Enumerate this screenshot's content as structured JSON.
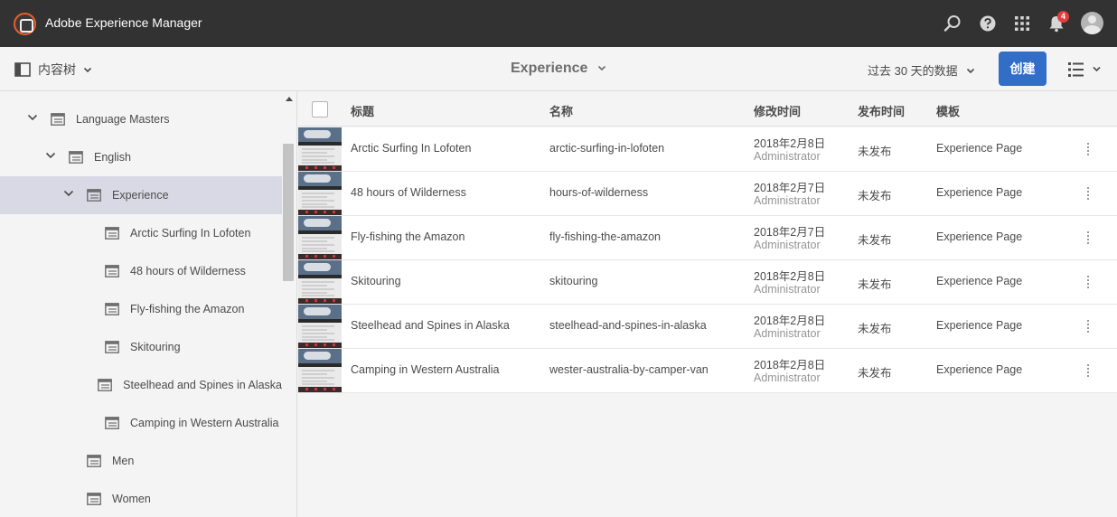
{
  "header": {
    "app_title": "Adobe Experience Manager",
    "notification_count": "4",
    "icons": [
      "search-icon",
      "help-icon",
      "solutions-grid-icon",
      "bell-icon",
      "user-avatar-icon"
    ]
  },
  "actionbar": {
    "rail_label": "内容树",
    "title": "Experience",
    "date_range": "过去 30 天的数据",
    "create_label": "创建"
  },
  "tree": [
    {
      "label": "Language Masters",
      "level": 0,
      "expanded": true,
      "selected": false
    },
    {
      "label": "English",
      "level": 1,
      "expanded": true,
      "selected": false
    },
    {
      "label": "Experience",
      "level": 2,
      "expanded": true,
      "selected": true
    },
    {
      "label": "Arctic Surfing In Lofoten",
      "level": 3,
      "expanded": false,
      "selected": false
    },
    {
      "label": "48 hours of Wilderness",
      "level": 3,
      "expanded": false,
      "selected": false
    },
    {
      "label": "Fly-fishing the Amazon",
      "level": 3,
      "expanded": false,
      "selected": false
    },
    {
      "label": "Skitouring",
      "level": 3,
      "expanded": false,
      "selected": false
    },
    {
      "label": "Steelhead and Spines in Alaska",
      "level": 3,
      "expanded": false,
      "selected": false
    },
    {
      "label": "Camping in Western Australia",
      "level": 3,
      "expanded": false,
      "selected": false
    },
    {
      "label": "Men",
      "level": 2,
      "expanded": false,
      "selected": false
    },
    {
      "label": "Women",
      "level": 2,
      "expanded": false,
      "selected": false
    }
  ],
  "table": {
    "columns": [
      "标题",
      "名称",
      "修改时间",
      "发布时间",
      "模板"
    ],
    "rows": [
      {
        "title": "Arctic Surfing In Lofoten",
        "name": "arctic-surfing-in-lofoten",
        "modified": "2018年2月8日",
        "modified_by": "Administrator",
        "published": "未发布",
        "template": "Experience Page"
      },
      {
        "title": "48 hours of Wilderness",
        "name": "hours-of-wilderness",
        "modified": "2018年2月7日",
        "modified_by": "Administrator",
        "published": "未发布",
        "template": "Experience Page"
      },
      {
        "title": "Fly-fishing the Amazon",
        "name": "fly-fishing-the-amazon",
        "modified": "2018年2月7日",
        "modified_by": "Administrator",
        "published": "未发布",
        "template": "Experience Page"
      },
      {
        "title": "Skitouring",
        "name": "skitouring",
        "modified": "2018年2月8日",
        "modified_by": "Administrator",
        "published": "未发布",
        "template": "Experience Page"
      },
      {
        "title": "Steelhead and Spines in Alaska",
        "name": "steelhead-and-spines-in-alaska",
        "modified": "2018年2月8日",
        "modified_by": "Administrator",
        "published": "未发布",
        "template": "Experience Page"
      },
      {
        "title": "Camping in Western Australia",
        "name": "wester-australia-by-camper-van",
        "modified": "2018年2月8日",
        "modified_by": "Administrator",
        "published": "未发布",
        "template": "Experience Page"
      }
    ]
  },
  "colors": {
    "header_bg": "#323232",
    "accent": "#326ec8",
    "selected_row": "#d9d9e6",
    "badge": "#e33d3d"
  }
}
